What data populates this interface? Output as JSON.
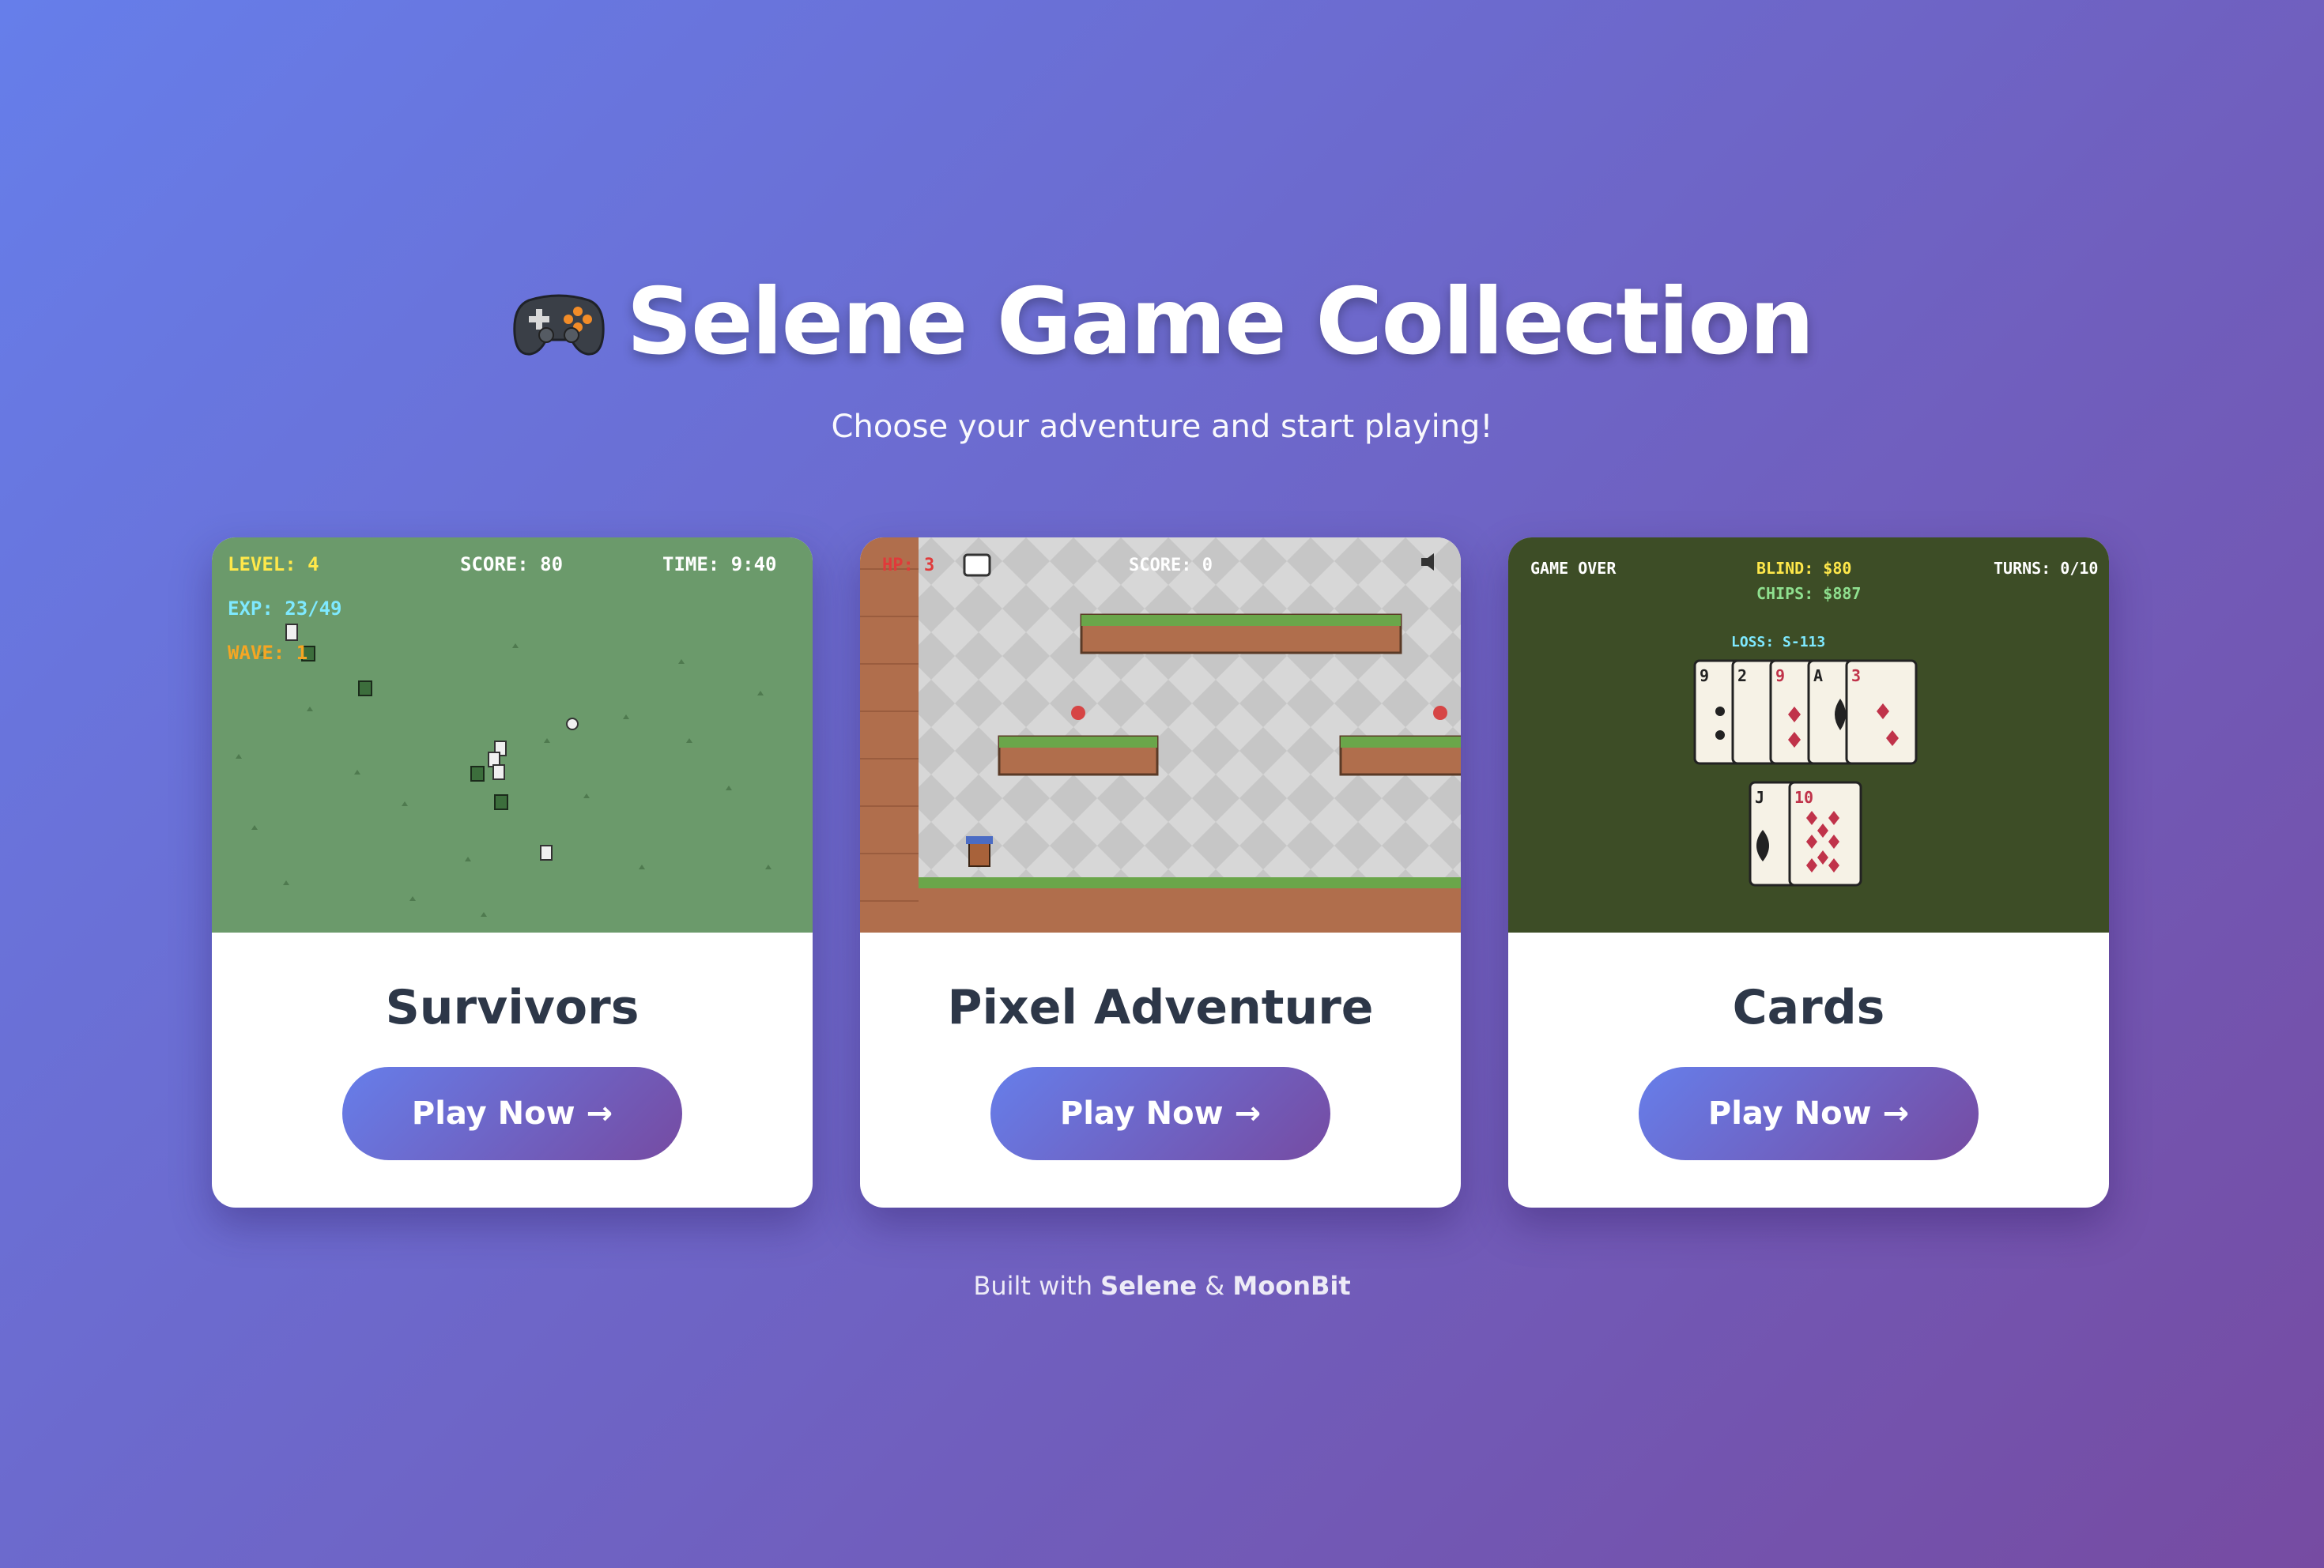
{
  "header": {
    "icon": "gamepad-icon",
    "title": "Selene Game Collection",
    "subtitle": "Choose your adventure and start playing!"
  },
  "games": [
    {
      "title": "Survivors",
      "button_label": "Play Now",
      "button_icon": "arrow-right-icon",
      "hud": {
        "level": "LEVEL: 4",
        "score": "SCORE: 80",
        "time": "TIME: 9:40",
        "exp": "EXP: 23/49",
        "wave": "WAVE: 1"
      },
      "colors": {
        "background": "#6b9a6b"
      }
    },
    {
      "title": "Pixel Adventure",
      "button_label": "Play Now",
      "button_icon": "arrow-right-icon",
      "hud": {
        "hp": "HP: 3",
        "score": "SCORE: 0"
      },
      "colors": {
        "background": "#cfcfcf",
        "ground": "#b06e4c",
        "grass": "#6aa64a"
      }
    },
    {
      "title": "Cards",
      "button_label": "Play Now",
      "button_icon": "arrow-right-icon",
      "hud": {
        "status": "GAME OVER",
        "blind": "BLIND: $80",
        "chips": "CHIPS: $887",
        "turns": "TURNS: 0/10",
        "loss": "LOSS: S-113"
      },
      "hand": [
        "9",
        "2",
        "9",
        "A",
        "3"
      ],
      "played": [
        "J",
        "10"
      ],
      "colors": {
        "background": "#3d4d26"
      }
    }
  ],
  "footer": {
    "prefix": "Built with",
    "brand1": "Selene",
    "separator": "&",
    "brand2": "MoonBit"
  },
  "colors": {
    "gradient_start": "#667eea",
    "gradient_end": "#764ba2",
    "title_text": "#2d3748"
  }
}
